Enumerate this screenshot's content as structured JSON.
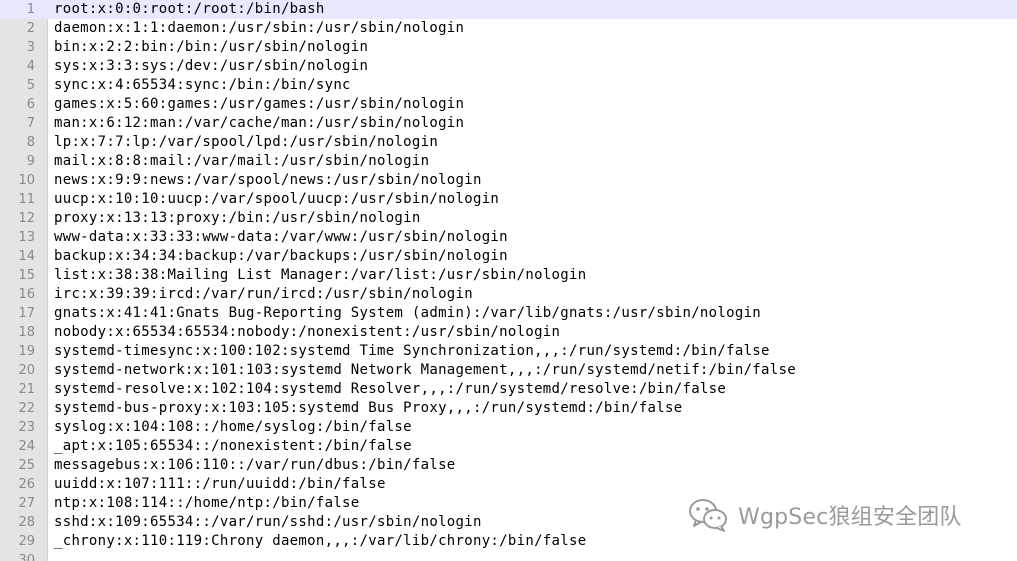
{
  "editor": {
    "current_line": 1,
    "lines": [
      {
        "num": "1",
        "text": "root:x:0:0:root:/root:/bin/bash"
      },
      {
        "num": "2",
        "text": "daemon:x:1:1:daemon:/usr/sbin:/usr/sbin/nologin"
      },
      {
        "num": "3",
        "text": "bin:x:2:2:bin:/bin:/usr/sbin/nologin"
      },
      {
        "num": "4",
        "text": "sys:x:3:3:sys:/dev:/usr/sbin/nologin"
      },
      {
        "num": "5",
        "text": "sync:x:4:65534:sync:/bin:/bin/sync"
      },
      {
        "num": "6",
        "text": "games:x:5:60:games:/usr/games:/usr/sbin/nologin"
      },
      {
        "num": "7",
        "text": "man:x:6:12:man:/var/cache/man:/usr/sbin/nologin"
      },
      {
        "num": "8",
        "text": "lp:x:7:7:lp:/var/spool/lpd:/usr/sbin/nologin"
      },
      {
        "num": "9",
        "text": "mail:x:8:8:mail:/var/mail:/usr/sbin/nologin"
      },
      {
        "num": "10",
        "text": "news:x:9:9:news:/var/spool/news:/usr/sbin/nologin"
      },
      {
        "num": "11",
        "text": "uucp:x:10:10:uucp:/var/spool/uucp:/usr/sbin/nologin"
      },
      {
        "num": "12",
        "text": "proxy:x:13:13:proxy:/bin:/usr/sbin/nologin"
      },
      {
        "num": "13",
        "text": "www-data:x:33:33:www-data:/var/www:/usr/sbin/nologin"
      },
      {
        "num": "14",
        "text": "backup:x:34:34:backup:/var/backups:/usr/sbin/nologin"
      },
      {
        "num": "15",
        "text": "list:x:38:38:Mailing List Manager:/var/list:/usr/sbin/nologin"
      },
      {
        "num": "16",
        "text": "irc:x:39:39:ircd:/var/run/ircd:/usr/sbin/nologin"
      },
      {
        "num": "17",
        "text": "gnats:x:41:41:Gnats Bug-Reporting System (admin):/var/lib/gnats:/usr/sbin/nologin"
      },
      {
        "num": "18",
        "text": "nobody:x:65534:65534:nobody:/nonexistent:/usr/sbin/nologin"
      },
      {
        "num": "19",
        "text": "systemd-timesync:x:100:102:systemd Time Synchronization,,,:/run/systemd:/bin/false"
      },
      {
        "num": "20",
        "text": "systemd-network:x:101:103:systemd Network Management,,,:/run/systemd/netif:/bin/false"
      },
      {
        "num": "21",
        "text": "systemd-resolve:x:102:104:systemd Resolver,,,:/run/systemd/resolve:/bin/false"
      },
      {
        "num": "22",
        "text": "systemd-bus-proxy:x:103:105:systemd Bus Proxy,,,:/run/systemd:/bin/false"
      },
      {
        "num": "23",
        "text": "syslog:x:104:108::/home/syslog:/bin/false"
      },
      {
        "num": "24",
        "text": "_apt:x:105:65534::/nonexistent:/bin/false"
      },
      {
        "num": "25",
        "text": "messagebus:x:106:110::/var/run/dbus:/bin/false"
      },
      {
        "num": "26",
        "text": "uuidd:x:107:111::/run/uuidd:/bin/false"
      },
      {
        "num": "27",
        "text": "ntp:x:108:114::/home/ntp:/bin/false"
      },
      {
        "num": "28",
        "text": "sshd:x:109:65534::/var/run/sshd:/usr/sbin/nologin"
      },
      {
        "num": "29",
        "text": "_chrony:x:110:119:Chrony daemon,,,:/var/lib/chrony:/bin/false"
      },
      {
        "num": "30",
        "text": ""
      }
    ]
  },
  "watermark": {
    "icon": "wechat-icon",
    "text": "WgpSec狼组安全团队"
  },
  "colors": {
    "gutter_bg": "#e4e4e4",
    "current_line_bg": "#e8e8ff",
    "line_number": "#8a8a8a",
    "text": "#000000",
    "watermark": "#9a9a9a"
  }
}
